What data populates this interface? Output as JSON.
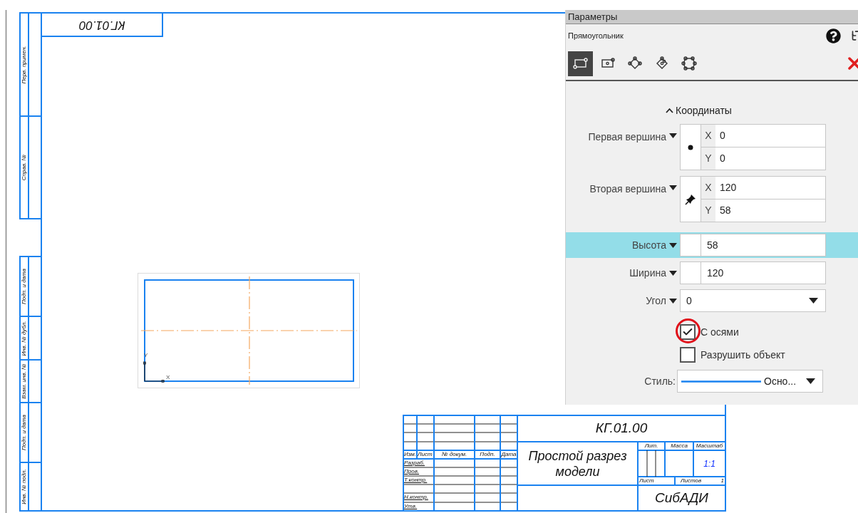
{
  "drawing": {
    "top_stamp": "КГ.01.00",
    "side_labels": [
      "Перв. примен.",
      "Справ. №",
      "Подп. и дата",
      "Инв. № дубл.",
      "Взам. инв. №",
      "Подп. и дата",
      "Инв. № подл."
    ],
    "sketch": {
      "axis_x": "X",
      "axis_y": "Y"
    },
    "title_block": {
      "designation": "КГ.01.00",
      "title": "Простой разрез модели",
      "columns": [
        "Изм.",
        "Лист",
        "№ докум.",
        "Подп.",
        "Дата"
      ],
      "roles": [
        "Разраб.",
        "Пров.",
        "Т.контр.",
        "Н.контр.",
        "Утв."
      ],
      "lit_label": "Лит.",
      "mass_label": "Масса",
      "scale_label": "Масштаб",
      "scale": "1:1",
      "sheet_label": "Лист",
      "sheets_label": "Листов",
      "sheets": "1",
      "organization": "СибАДИ"
    }
  },
  "panel": {
    "title": "Параметры",
    "command": "Прямоугольник",
    "modes": [
      {
        "kind": "corners",
        "selected": true
      },
      {
        "kind": "center",
        "selected": false
      },
      {
        "kind": "rotated",
        "selected": false
      },
      {
        "kind": "rotated-center",
        "selected": false
      },
      {
        "kind": "rounded",
        "selected": false
      }
    ],
    "section": "Координаты",
    "expanded": true,
    "points": [
      {
        "label": "Первая вершина",
        "kind": "dot",
        "coords": [
          {
            "axis": "X",
            "value": "0"
          },
          {
            "axis": "Y",
            "value": "0"
          }
        ]
      },
      {
        "label": "Вторая вершина",
        "kind": "pin",
        "coords": [
          {
            "axis": "X",
            "value": "120"
          },
          {
            "axis": "Y",
            "value": "58"
          }
        ]
      }
    ],
    "fields": [
      {
        "label": "Высота",
        "value": "58",
        "kind": "number",
        "highlighted": true
      },
      {
        "label": "Ширина",
        "value": "120",
        "kind": "number",
        "highlighted": false
      },
      {
        "label": "Угол",
        "value": "0",
        "kind": "dropdown",
        "highlighted": false
      }
    ],
    "checkboxes": [
      {
        "label": "С осями",
        "checked": true,
        "annotated": true
      },
      {
        "label": "Разрушить объект",
        "checked": false,
        "annotated": false
      }
    ],
    "style": {
      "label": "Стиль:",
      "value": "Осно..."
    }
  }
}
